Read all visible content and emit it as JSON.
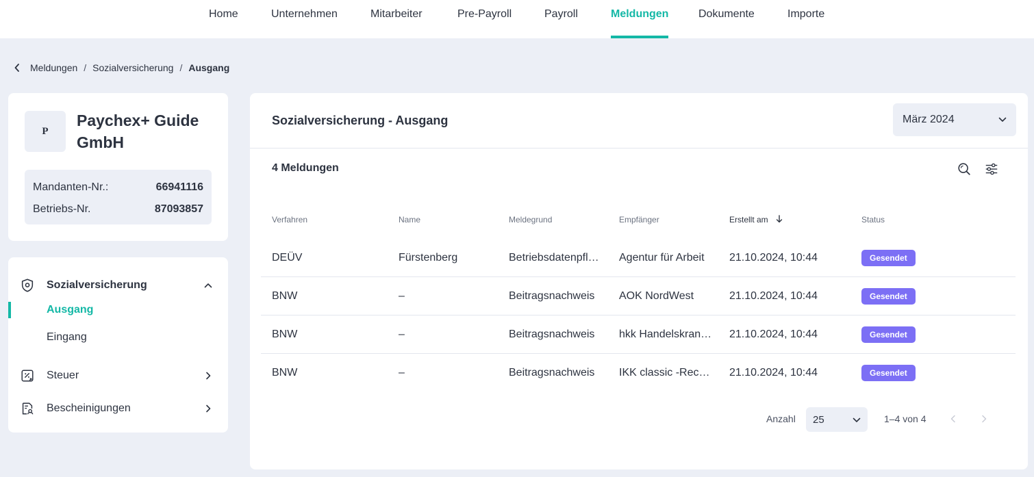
{
  "nav": {
    "items": [
      {
        "label": "Home"
      },
      {
        "label": "Unternehmen"
      },
      {
        "label": "Mitarbeiter"
      },
      {
        "label": "Pre-Payroll"
      },
      {
        "label": "Payroll"
      },
      {
        "label": "Meldungen",
        "active": true
      },
      {
        "label": "Dokumente"
      },
      {
        "label": "Importe"
      }
    ]
  },
  "breadcrumb": {
    "back_icon": "chevron-left-icon",
    "items": [
      "Meldungen",
      "Sozialversicherung",
      "Ausgang"
    ],
    "separator": "/"
  },
  "company": {
    "logo_letter": "P",
    "name": "Paychex+ Guide GmbH",
    "ids": [
      {
        "label": "Mandanten-Nr.:",
        "value": "66941116"
      },
      {
        "label": "Betriebs-Nr.",
        "value": "87093857"
      }
    ]
  },
  "sidebar": {
    "sections": [
      {
        "label": "Sozialversicherung",
        "icon": "shield-icon",
        "expanded": true,
        "children": [
          {
            "label": "Ausgang",
            "active": true
          },
          {
            "label": "Eingang"
          }
        ]
      },
      {
        "label": "Steuer",
        "icon": "tax-icon"
      },
      {
        "label": "Bescheinigungen",
        "icon": "certificate-icon"
      }
    ]
  },
  "main": {
    "title": "Sozialversicherung - Ausgang",
    "month_select": "März 2024",
    "count_label": "4 Meldungen",
    "tools": [
      "search-icon",
      "filter-sliders-icon"
    ],
    "table": {
      "columns": [
        "Verfahren",
        "Name",
        "Meldegrund",
        "Empfänger",
        "Erstellt am",
        "Status"
      ],
      "sorted_column": "Erstellt am",
      "rows": [
        {
          "verfahren": "DEÜV",
          "name": "Fürstenberg",
          "meldegrund": "Betriebsdatenpfl…",
          "empfaenger": "Agentur für Arbeit",
          "erstellt": "21.10.2024, 10:44",
          "status": "Gesendet"
        },
        {
          "verfahren": "BNW",
          "name": "–",
          "meldegrund": "Beitragsnachweis",
          "empfaenger": "AOK NordWest",
          "erstellt": "21.10.2024, 10:44",
          "status": "Gesendet"
        },
        {
          "verfahren": "BNW",
          "name": "–",
          "meldegrund": "Beitragsnachweis",
          "empfaenger": "hkk Handelskran…",
          "erstellt": "21.10.2024, 10:44",
          "status": "Gesendet"
        },
        {
          "verfahren": "BNW",
          "name": "–",
          "meldegrund": "Beitragsnachweis",
          "empfaenger": "IKK classic -Rec…",
          "erstellt": "21.10.2024, 10:44",
          "status": "Gesendet"
        }
      ]
    },
    "pagination": {
      "label": "Anzahl",
      "page_size": "25",
      "range": "1–4 von 4"
    }
  },
  "colors": {
    "accent": "#14b8a6",
    "badge": "#7c6ff5",
    "background": "#eceff6"
  }
}
